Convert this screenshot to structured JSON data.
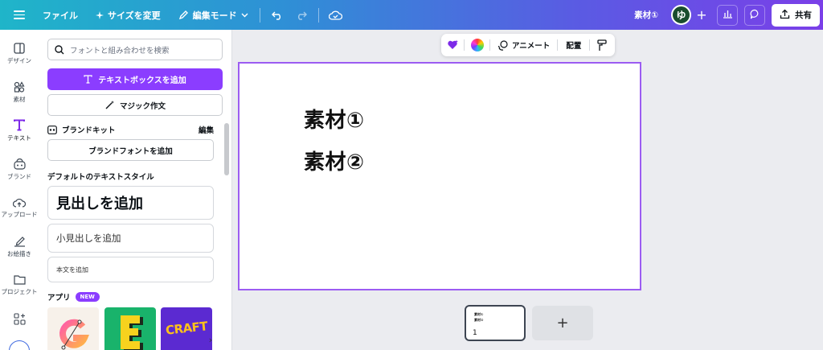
{
  "topbar": {
    "file": "ファイル",
    "resize": "サイズを変更",
    "edit_mode": "編集モード",
    "title": "素材①",
    "avatar_initial": "ゆ",
    "share": "共有"
  },
  "rail": {
    "items": [
      {
        "label": "デザイン",
        "icon": "design-icon"
      },
      {
        "label": "素材",
        "icon": "elements-icon"
      },
      {
        "label": "テキスト",
        "icon": "text-icon"
      },
      {
        "label": "ブランド",
        "icon": "brand-icon"
      },
      {
        "label": "アップロード",
        "icon": "upload-icon"
      },
      {
        "label": "お絵描き",
        "icon": "draw-icon"
      },
      {
        "label": "プロジェクト",
        "icon": "folder-icon"
      }
    ]
  },
  "panel": {
    "search_placeholder": "フォントと組み合わせを検索",
    "add_textbox": "テキストボックスを追加",
    "magic_write": "マジック作文",
    "brand_kit": "ブランドキット",
    "edit": "編集",
    "add_brand_font": "ブランドフォントを追加",
    "default_styles": "デフォルトのテキストスタイル",
    "heading": "見出しを追加",
    "subheading": "小見出しを追加",
    "body": "本文を追加",
    "apps": "アプリ",
    "new_badge": "NEW",
    "app_craft_label": "CRAFT"
  },
  "float_toolbar": {
    "animate": "アニメート",
    "position": "配置"
  },
  "canvas": {
    "text1": "素材①",
    "text2": "素材②"
  },
  "pages": {
    "page_number": "1",
    "mini1": "素材①",
    "mini2": "素材②"
  },
  "colors": {
    "accent": "#8b3dff",
    "artboard_border": "#9c5cf2"
  }
}
